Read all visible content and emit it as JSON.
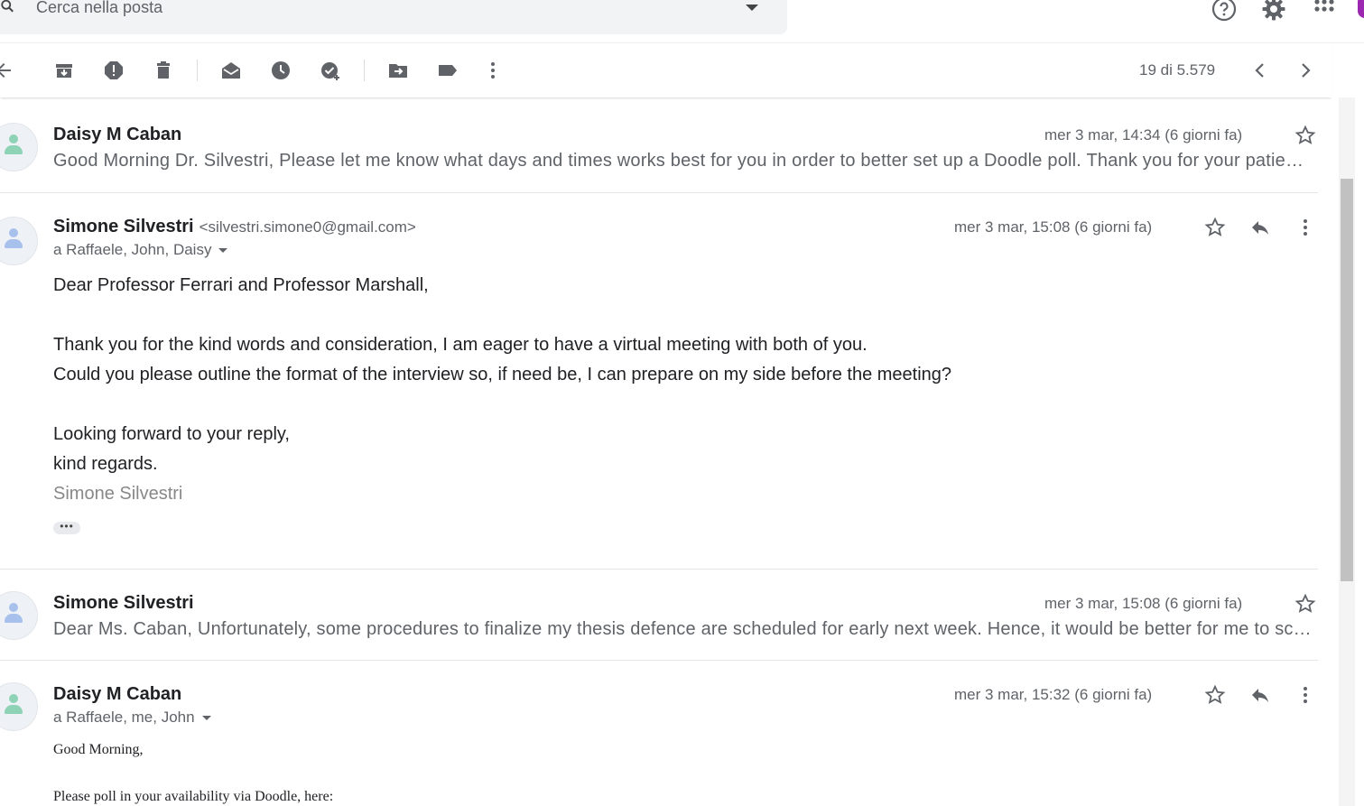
{
  "search": {
    "placeholder": "Cerca nella posta"
  },
  "top_icons": [
    "help-icon",
    "settings-gear-icon",
    "apps-grid-icon"
  ],
  "toolbar": {
    "buttons": [
      "back-arrow-icon",
      "archive-icon",
      "report-spam-icon",
      "delete-icon",
      "mark-unread-icon",
      "snooze-icon",
      "add-to-tasks-icon",
      "move-to-icon",
      "labels-icon",
      "more-vert-icon"
    ],
    "pager": "19 di 5.579"
  },
  "messages": [
    {
      "sender": "Daisy M Caban",
      "date": "mer 3 mar, 14:34 (6 giorni fa)",
      "snippet": "Good Morning Dr. Silvestri, Please let me know what days and times works best for you in order to better set up a Doodle poll. Thank you for your patience.",
      "avatar_color": "#8fd3b6"
    },
    {
      "sender": "Simone Silvestri",
      "sender_email": "<silvestri.simone0@gmail.com>",
      "date": "mer 3 mar, 15:08 (6 giorni fa)",
      "recipients": "a Raffaele, John, Daisy",
      "body": {
        "greeting": "Dear Professor Ferrari and Professor Marshall,",
        "line1": "Thank you for the kind words and consideration, I am eager to have a virtual meeting with both of you.",
        "line2": "Could you please outline the format of the interview so, if need be, I can prepare on my side before the meeting?",
        "closing1": "Looking forward to your reply,",
        "closing2": "kind regards.",
        "signature": "Simone Silvestri"
      },
      "show_trimmed": "•••",
      "avatar_color": "#a7c1ec"
    },
    {
      "sender": "Simone Silvestri",
      "date": "mer 3 mar, 15:08 (6 giorni fa)",
      "snippet": "Dear Ms. Caban, Unfortunately, some procedures to finalize my thesis defence are scheduled for early next week. Hence, it would be better for me to schedule the meeting later.",
      "avatar_color": "#a7c1ec"
    },
    {
      "sender": "Daisy M Caban",
      "date": "mer 3 mar, 15:32 (6 giorni fa)",
      "recipients": "a Raffaele, me, John",
      "body": {
        "line1": "Good Morning,",
        "line2": "Please poll in your availability via Doodle, here:"
      },
      "avatar_color": "#8fd3b6"
    }
  ]
}
